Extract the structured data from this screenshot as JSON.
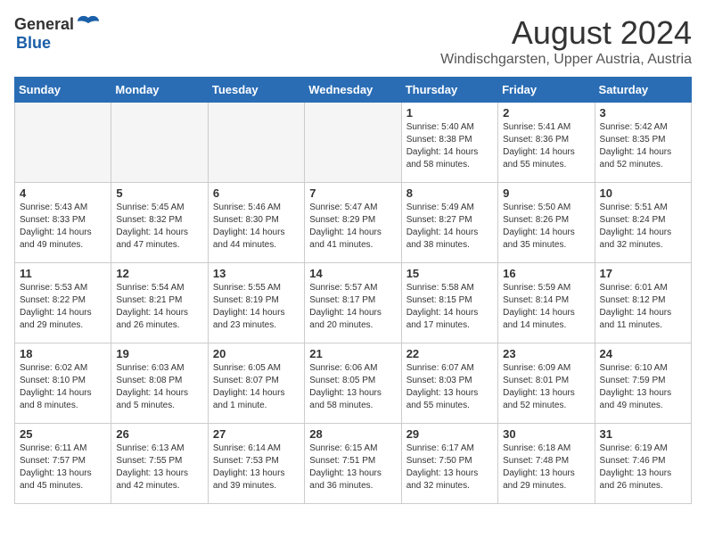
{
  "logo": {
    "general": "General",
    "blue": "Blue"
  },
  "title": "August 2024",
  "location": "Windischgarsten, Upper Austria, Austria",
  "days": [
    "Sunday",
    "Monday",
    "Tuesday",
    "Wednesday",
    "Thursday",
    "Friday",
    "Saturday"
  ],
  "weeks": [
    [
      {
        "day": "",
        "info": ""
      },
      {
        "day": "",
        "info": ""
      },
      {
        "day": "",
        "info": ""
      },
      {
        "day": "",
        "info": ""
      },
      {
        "day": "1",
        "info": "Sunrise: 5:40 AM\nSunset: 8:38 PM\nDaylight: 14 hours\nand 58 minutes."
      },
      {
        "day": "2",
        "info": "Sunrise: 5:41 AM\nSunset: 8:36 PM\nDaylight: 14 hours\nand 55 minutes."
      },
      {
        "day": "3",
        "info": "Sunrise: 5:42 AM\nSunset: 8:35 PM\nDaylight: 14 hours\nand 52 minutes."
      }
    ],
    [
      {
        "day": "4",
        "info": "Sunrise: 5:43 AM\nSunset: 8:33 PM\nDaylight: 14 hours\nand 49 minutes."
      },
      {
        "day": "5",
        "info": "Sunrise: 5:45 AM\nSunset: 8:32 PM\nDaylight: 14 hours\nand 47 minutes."
      },
      {
        "day": "6",
        "info": "Sunrise: 5:46 AM\nSunset: 8:30 PM\nDaylight: 14 hours\nand 44 minutes."
      },
      {
        "day": "7",
        "info": "Sunrise: 5:47 AM\nSunset: 8:29 PM\nDaylight: 14 hours\nand 41 minutes."
      },
      {
        "day": "8",
        "info": "Sunrise: 5:49 AM\nSunset: 8:27 PM\nDaylight: 14 hours\nand 38 minutes."
      },
      {
        "day": "9",
        "info": "Sunrise: 5:50 AM\nSunset: 8:26 PM\nDaylight: 14 hours\nand 35 minutes."
      },
      {
        "day": "10",
        "info": "Sunrise: 5:51 AM\nSunset: 8:24 PM\nDaylight: 14 hours\nand 32 minutes."
      }
    ],
    [
      {
        "day": "11",
        "info": "Sunrise: 5:53 AM\nSunset: 8:22 PM\nDaylight: 14 hours\nand 29 minutes."
      },
      {
        "day": "12",
        "info": "Sunrise: 5:54 AM\nSunset: 8:21 PM\nDaylight: 14 hours\nand 26 minutes."
      },
      {
        "day": "13",
        "info": "Sunrise: 5:55 AM\nSunset: 8:19 PM\nDaylight: 14 hours\nand 23 minutes."
      },
      {
        "day": "14",
        "info": "Sunrise: 5:57 AM\nSunset: 8:17 PM\nDaylight: 14 hours\nand 20 minutes."
      },
      {
        "day": "15",
        "info": "Sunrise: 5:58 AM\nSunset: 8:15 PM\nDaylight: 14 hours\nand 17 minutes."
      },
      {
        "day": "16",
        "info": "Sunrise: 5:59 AM\nSunset: 8:14 PM\nDaylight: 14 hours\nand 14 minutes."
      },
      {
        "day": "17",
        "info": "Sunrise: 6:01 AM\nSunset: 8:12 PM\nDaylight: 14 hours\nand 11 minutes."
      }
    ],
    [
      {
        "day": "18",
        "info": "Sunrise: 6:02 AM\nSunset: 8:10 PM\nDaylight: 14 hours\nand 8 minutes."
      },
      {
        "day": "19",
        "info": "Sunrise: 6:03 AM\nSunset: 8:08 PM\nDaylight: 14 hours\nand 5 minutes."
      },
      {
        "day": "20",
        "info": "Sunrise: 6:05 AM\nSunset: 8:07 PM\nDaylight: 14 hours\nand 1 minute."
      },
      {
        "day": "21",
        "info": "Sunrise: 6:06 AM\nSunset: 8:05 PM\nDaylight: 13 hours\nand 58 minutes."
      },
      {
        "day": "22",
        "info": "Sunrise: 6:07 AM\nSunset: 8:03 PM\nDaylight: 13 hours\nand 55 minutes."
      },
      {
        "day": "23",
        "info": "Sunrise: 6:09 AM\nSunset: 8:01 PM\nDaylight: 13 hours\nand 52 minutes."
      },
      {
        "day": "24",
        "info": "Sunrise: 6:10 AM\nSunset: 7:59 PM\nDaylight: 13 hours\nand 49 minutes."
      }
    ],
    [
      {
        "day": "25",
        "info": "Sunrise: 6:11 AM\nSunset: 7:57 PM\nDaylight: 13 hours\nand 45 minutes."
      },
      {
        "day": "26",
        "info": "Sunrise: 6:13 AM\nSunset: 7:55 PM\nDaylight: 13 hours\nand 42 minutes."
      },
      {
        "day": "27",
        "info": "Sunrise: 6:14 AM\nSunset: 7:53 PM\nDaylight: 13 hours\nand 39 minutes."
      },
      {
        "day": "28",
        "info": "Sunrise: 6:15 AM\nSunset: 7:51 PM\nDaylight: 13 hours\nand 36 minutes."
      },
      {
        "day": "29",
        "info": "Sunrise: 6:17 AM\nSunset: 7:50 PM\nDaylight: 13 hours\nand 32 minutes."
      },
      {
        "day": "30",
        "info": "Sunrise: 6:18 AM\nSunset: 7:48 PM\nDaylight: 13 hours\nand 29 minutes."
      },
      {
        "day": "31",
        "info": "Sunrise: 6:19 AM\nSunset: 7:46 PM\nDaylight: 13 hours\nand 26 minutes."
      }
    ]
  ]
}
